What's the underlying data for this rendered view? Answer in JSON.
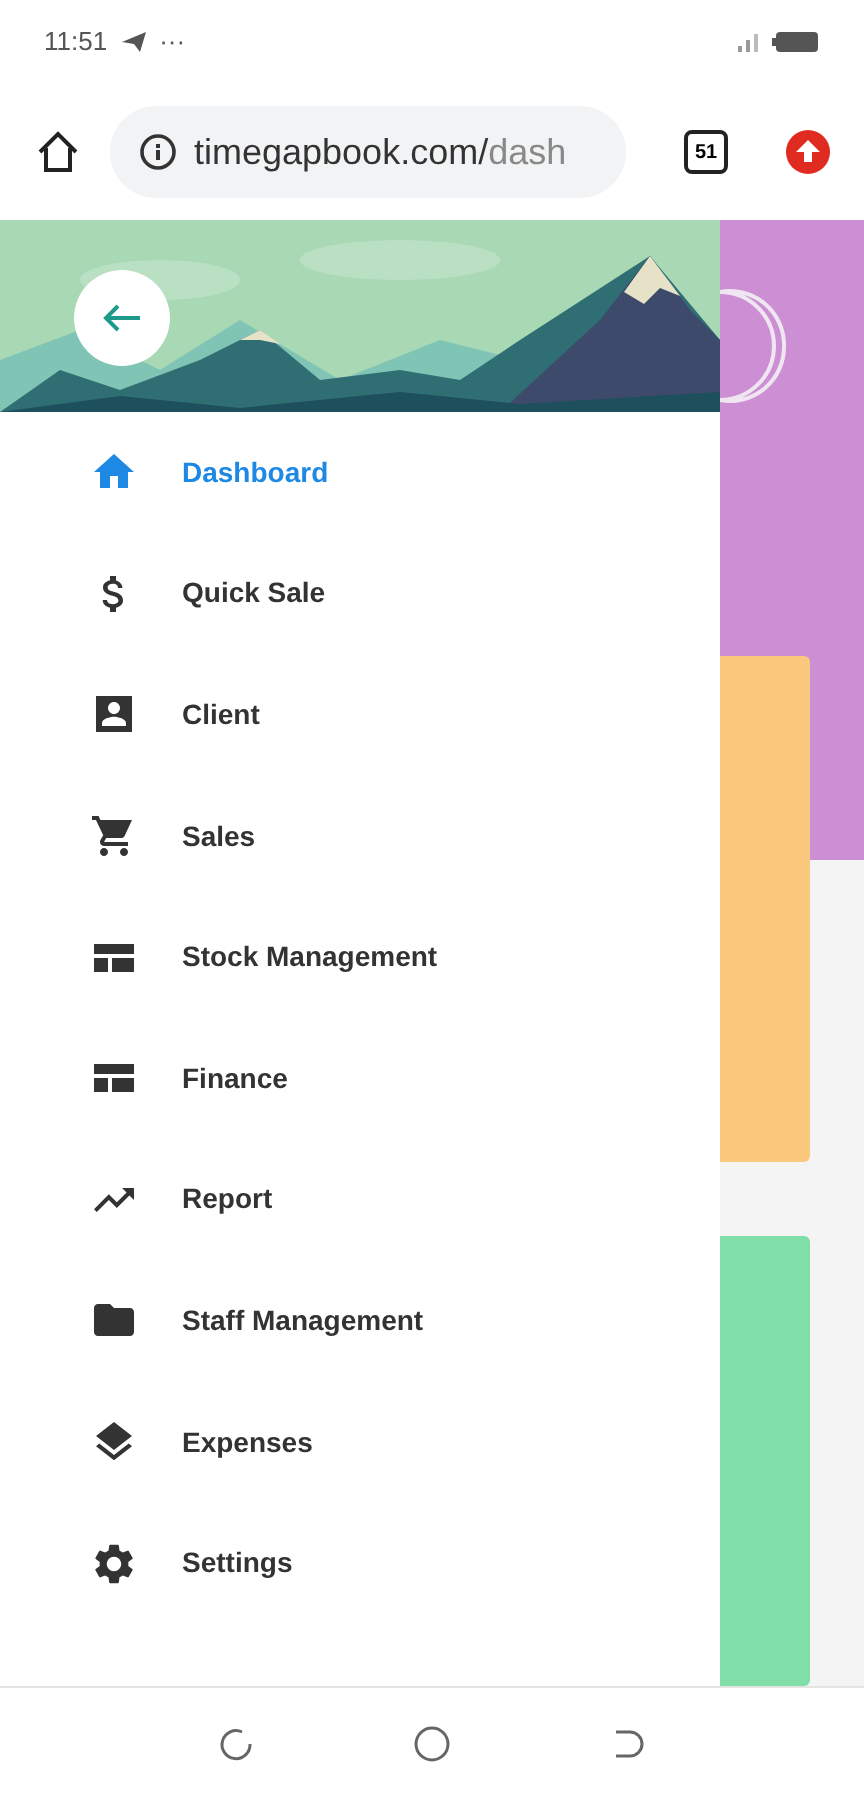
{
  "status_bar": {
    "time": "11:51",
    "more": "···"
  },
  "browser": {
    "url_host": "timegapbook.com/",
    "url_path": "dash",
    "tab_count": "51"
  },
  "drawer": {
    "items": [
      {
        "label": "Dashboard",
        "selected": true
      },
      {
        "label": "Quick Sale",
        "selected": false
      },
      {
        "label": "Client",
        "selected": false
      },
      {
        "label": "Sales",
        "selected": false
      },
      {
        "label": "Stock Management",
        "selected": false
      },
      {
        "label": "Finance",
        "selected": false
      },
      {
        "label": "Report",
        "selected": false
      },
      {
        "label": "Staff Management",
        "selected": false
      },
      {
        "label": "Expenses",
        "selected": false
      },
      {
        "label": "Settings",
        "selected": false
      }
    ]
  }
}
